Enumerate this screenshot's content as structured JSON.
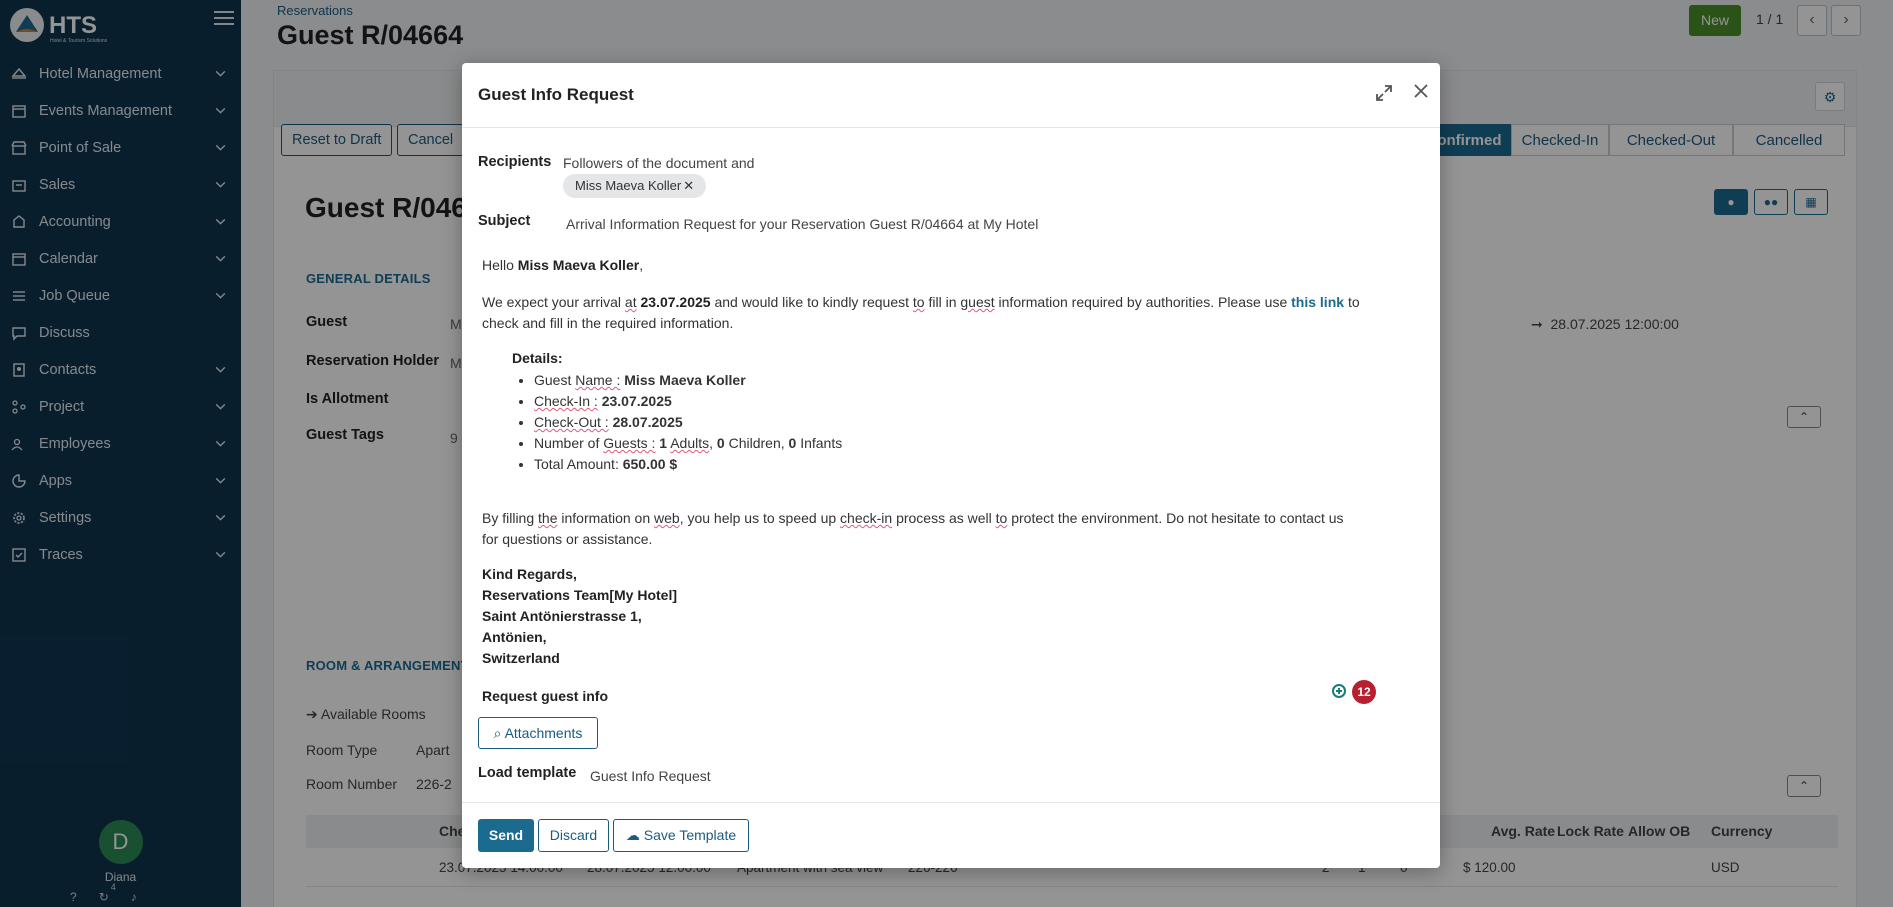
{
  "app": {
    "name": "HTS",
    "tagline": "Hotel & Tourism Solutions"
  },
  "sidebar": {
    "items": [
      {
        "label": "Hotel Management",
        "icon": "bed-icon"
      },
      {
        "label": "Events Management",
        "icon": "calendar-icon"
      },
      {
        "label": "Point of Sale",
        "icon": "store-icon"
      },
      {
        "label": "Sales",
        "icon": "chart-icon"
      },
      {
        "label": "Accounting",
        "icon": "money-icon"
      },
      {
        "label": "Calendar",
        "icon": "calendar-icon"
      },
      {
        "label": "Job Queue",
        "icon": "list-icon"
      },
      {
        "label": "Discuss",
        "icon": "chat-icon"
      },
      {
        "label": "Contacts",
        "icon": "contact-icon"
      },
      {
        "label": "Project",
        "icon": "project-icon"
      },
      {
        "label": "Employees",
        "icon": "people-icon"
      },
      {
        "label": "Apps",
        "icon": "apps-icon"
      },
      {
        "label": "Settings",
        "icon": "gear-icon"
      },
      {
        "label": "Traces",
        "icon": "check-icon"
      }
    ],
    "user": {
      "initial": "D",
      "name": "Diana"
    },
    "activity_count": "4"
  },
  "page": {
    "breadcrumb": "Reservations",
    "title": "Guest R/04664",
    "new_button": "New",
    "pager": "1 / 1",
    "actions": {
      "reset_to_draft": "Reset to Draft",
      "cancel": "Cancel"
    },
    "stages": [
      "Confirmed",
      "Checked-In",
      "Checked-Out",
      "Cancelled"
    ],
    "active_stage": "Confirmed",
    "form_title": "Guest R/046",
    "general_details": "GENERAL DETAILS",
    "fields": {
      "guest": "Guest",
      "guest_val": "M",
      "reservation_holder": "Reservation Holder",
      "holder_val": "M",
      "is_allotment": "Is Allotment",
      "guest_tags": "Guest Tags",
      "tags_val": "9"
    },
    "checkout_date": "28.07.2025 12:00:00",
    "room_section": "ROOM & ARRANGEMENT",
    "available_rooms": "Available Rooms",
    "room_type": "Room Type",
    "room_type_val": "Apart",
    "room_number": "Room Number",
    "room_number_val": "226-2",
    "table": {
      "headers": {
        "che": "Che",
        "avg_rate": "Avg. Rate",
        "lock_rate": "Lock Rate",
        "allow_ob": "Allow OB",
        "currency": "Currency"
      },
      "row": {
        "checkin": "23.07.2025 14:00:00",
        "checkout": "28.07.2025 12:00:00",
        "room_type": "Apartment with sea view",
        "room": "226-226",
        "adults": "2",
        "children": "1",
        "infants": "0",
        "rate": "$ 120.00",
        "currency": "USD"
      }
    }
  },
  "modal": {
    "title": "Guest Info Request",
    "recipients_label": "Recipients",
    "recipients_text": "Followers of the document and",
    "recipient_tag": "Miss Maeva Koller",
    "subject_label": "Subject",
    "subject": "Arrival Information Request for your Reservation Guest R/04664 at My Hotel",
    "body": {
      "greeting_prefix": "Hello",
      "guest_name": "Miss Maeva Koller",
      "greeting_suffix": ",",
      "p1_a": "We expect your arrival",
      "p1_at": "at",
      "p1_date": "23.07.2025",
      "p1_b": "and would like to kindly request",
      "p1_to": "to",
      "p1_c": "fill in",
      "p1_guest": "guest",
      "p1_d": "information required by authorities. Please use",
      "p1_link": "this link",
      "p1_e": "to",
      "p1_line2": "check and fill in the required information.",
      "details_head": "Details:",
      "d_guest_label_a": "Guest",
      "d_guest_label_b": "Name :",
      "d_guest_val": "Miss Maeva Koller",
      "d_checkin_label": "Check-In :",
      "d_checkin_val": "23.07.2025",
      "d_checkout_label": "Check-Out :",
      "d_checkout_val": "28.07.2025",
      "d_num_a": "Number of",
      "d_num_guests": "Guests :",
      "d_num_adults_n": "1",
      "d_num_adults": "Adults",
      "d_num_children_n": "0",
      "d_num_children": "Children,",
      "d_num_infants_n": "0",
      "d_num_infants": "Infants",
      "d_total_label": "Total Amount:",
      "d_total_val": "650.00 $",
      "p2_a": "By filling",
      "p2_the": "the",
      "p2_b": "information on",
      "p2_web": "web",
      "p2_c": ", you help us to speed up",
      "p2_checkin": "check-in",
      "p2_d": "process as well",
      "p2_to": "to",
      "p2_e": "protect the environment. Do not hesitate to contact us",
      "p2_line2": "for questions or assistance.",
      "sig": [
        "Kind Regards,",
        "Reservations Team[My Hotel]",
        "Saint Antönierstrasse 1,",
        "Antönien,",
        "Switzerland"
      ],
      "request_guest_info": "Request guest info"
    },
    "badge_count": "12",
    "attachments": "Attachments",
    "load_template_label": "Load template",
    "load_template_val": "Guest Info Request",
    "footer": {
      "send": "Send",
      "discard": "Discard",
      "save_template": "Save Template"
    }
  }
}
